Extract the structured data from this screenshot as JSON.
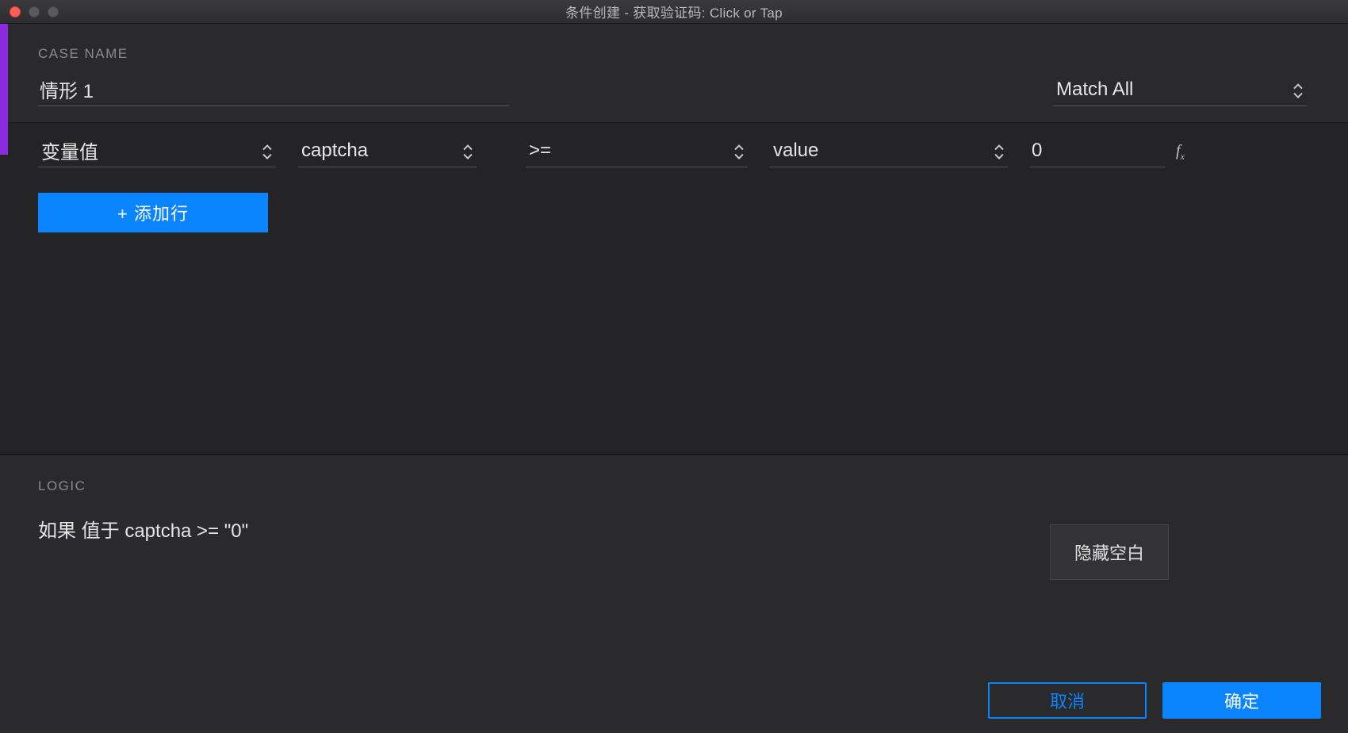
{
  "title": "条件创建   -   获取验证码: Click or Tap",
  "case": {
    "label": "CASE NAME",
    "name": "情形 1"
  },
  "match": {
    "selected": "Match All"
  },
  "condition": {
    "type": "变量值",
    "variable": "captcha",
    "operator": ">=",
    "source": "value",
    "value": "0"
  },
  "add_row": "+ 添加行",
  "logic": {
    "label": "LOGIC",
    "text": "如果 值于 captcha >= \"0\"",
    "hide_blank": "隐藏空白"
  },
  "buttons": {
    "cancel": "取消",
    "ok": "确定"
  }
}
